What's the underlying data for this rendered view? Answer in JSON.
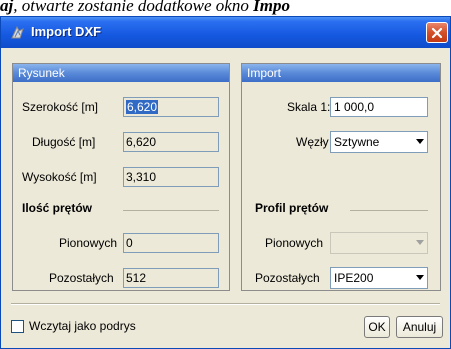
{
  "doc_text": {
    "part1": "aj",
    "part2": ", otwarte zostanie dodatkowe okno ",
    "part3": "Impo"
  },
  "window": {
    "title": "Import DXF",
    "icon": "dxf-app-icon",
    "close_icon": "close-icon"
  },
  "rysunek": {
    "header": "Rysunek",
    "width_label": "Szerokość [m]",
    "width_value": "6,620",
    "length_label": "Długość [m]",
    "length_value": "6,620",
    "height_label": "Wysokość [m]",
    "height_value": "3,310",
    "bars_section": "Ilość prętów",
    "vertical_label": "Pionowych",
    "vertical_value": "0",
    "other_label": "Pozostałych",
    "other_value": "512"
  },
  "import": {
    "header": "Import",
    "scale_label": "Skala 1:",
    "scale_value": "1 000,0",
    "nodes_label": "Węzły",
    "nodes_value": "Sztywne",
    "profile_section": "Profil prętów",
    "vertical_label": "Pionowych",
    "vertical_value": "",
    "other_label": "Pozostałych",
    "other_value": "IPE200"
  },
  "footer": {
    "checkbox_label": "Wczytaj jako podrys",
    "checkbox_checked": false,
    "ok_label": "OK",
    "cancel_label": "Anuluj"
  }
}
